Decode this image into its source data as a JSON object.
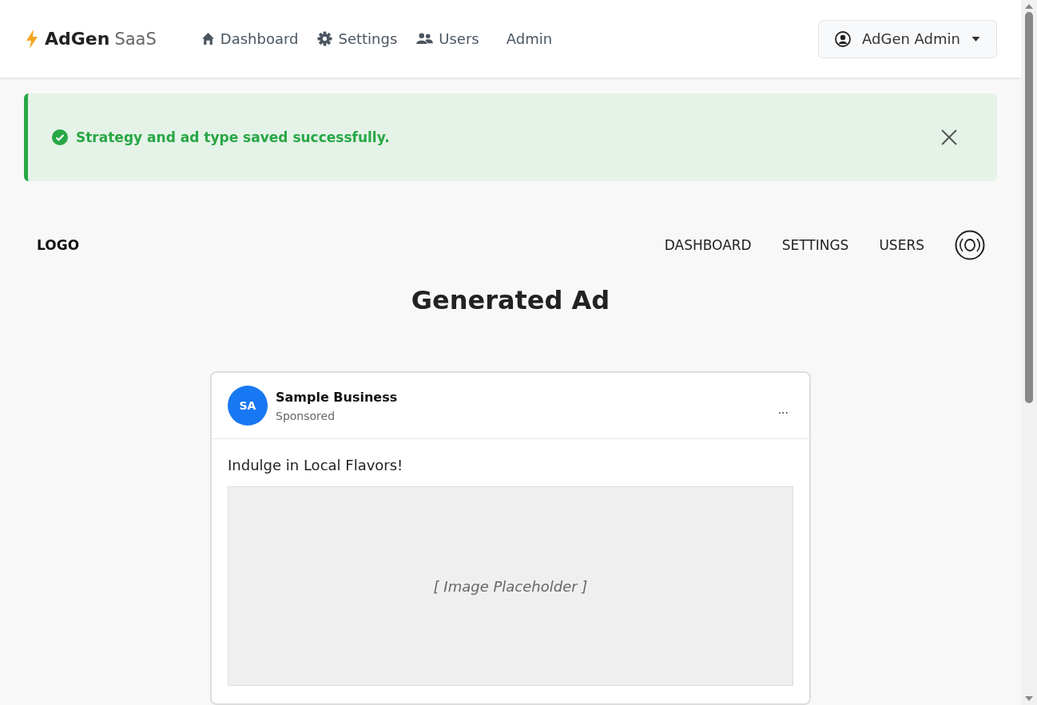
{
  "brand": {
    "name": "AdGen",
    "suffix": "SaaS"
  },
  "nav": [
    {
      "label": "Dashboard"
    },
    {
      "label": "Settings"
    },
    {
      "label": "Users"
    },
    {
      "label": "Admin"
    }
  ],
  "user_menu": {
    "label": "AdGen Admin"
  },
  "alert": {
    "kind": "success",
    "message": "Strategy and ad type saved successfully."
  },
  "inner_nav": {
    "logo": "LOGO",
    "links": [
      "DASHBOARD",
      "SETTINGS",
      "USERS"
    ]
  },
  "heading": "Generated Ad",
  "ad": {
    "avatar": "SA",
    "business": "Sample Business",
    "sponsored": "Sponsored",
    "more": "...",
    "headline": "Indulge in Local Flavors!",
    "image_placeholder": "[ Image Placeholder ]"
  }
}
